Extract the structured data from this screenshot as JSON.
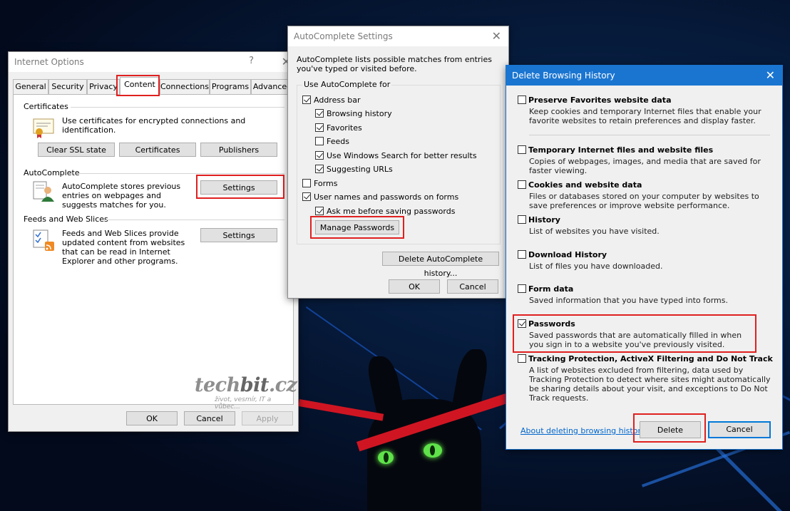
{
  "internet_options": {
    "title": "Internet Options",
    "help": "?",
    "close": "✕",
    "tabs": [
      "General",
      "Security",
      "Privacy",
      "Content",
      "Connections",
      "Programs",
      "Advanced"
    ],
    "selected_tab": "Content",
    "certificates": {
      "heading": "Certificates",
      "text": "Use certificates for encrypted connections and identification.",
      "buttons": [
        "Clear SSL state",
        "Certificates",
        "Publishers"
      ]
    },
    "autocomplete": {
      "heading": "AutoComplete",
      "text": "AutoComplete stores previous entries on webpages and suggests matches for you.",
      "button": "Settings"
    },
    "feeds": {
      "heading": "Feeds and Web Slices",
      "text": "Feeds and Web Slices provide updated content from websites that can be read in Internet Explorer and other programs.",
      "button": "Settings"
    },
    "watermark": {
      "part1": "tech",
      "part2": "bit",
      "part3": ".cz",
      "tagline": "život, vesmír, IT a vůbec..."
    },
    "footer": {
      "ok": "OK",
      "cancel": "Cancel",
      "apply": "Apply"
    }
  },
  "autocomplete_settings": {
    "title": "AutoComplete Settings",
    "close": "✕",
    "intro": "AutoComplete lists possible matches from entries you've typed or visited before.",
    "group_label": "Use AutoComplete for",
    "options": {
      "address_bar": {
        "label": "Address bar",
        "checked": true
      },
      "browsing_history": {
        "label": "Browsing history",
        "checked": true
      },
      "favorites": {
        "label": "Favorites",
        "checked": true
      },
      "feeds": {
        "label": "Feeds",
        "checked": false
      },
      "windows_search": {
        "label": "Use Windows Search for better results",
        "checked": true
      },
      "suggesting_urls": {
        "label": "Suggesting URLs",
        "checked": true
      },
      "forms": {
        "label": "Forms",
        "checked": false
      },
      "usernames": {
        "label": "User names and passwords on forms",
        "checked": true
      },
      "ask_before": {
        "label": "Ask me before saving passwords",
        "checked": true
      }
    },
    "manage_passwords": "Manage Passwords",
    "delete_history": "Delete AutoComplete history...",
    "ok": "OK",
    "cancel": "Cancel"
  },
  "delete_history": {
    "title": "Delete Browsing History",
    "close": "✕",
    "items": {
      "preserve": {
        "label": "Preserve Favorites website data",
        "desc": "Keep cookies and temporary Internet files that enable your favorite websites to retain preferences and display faster.",
        "checked": false
      },
      "temp_files": {
        "label": "Temporary Internet files and website files",
        "desc": "Copies of webpages, images, and media that are saved for faster viewing.",
        "checked": false
      },
      "cookies": {
        "label": "Cookies and website data",
        "desc": "Files or databases stored on your computer by websites to save preferences or improve website performance.",
        "checked": false
      },
      "history": {
        "label": "History",
        "desc": "List of websites you have visited.",
        "checked": false
      },
      "download_history": {
        "label": "Download History",
        "desc": "List of files you have downloaded.",
        "checked": false
      },
      "form_data": {
        "label": "Form data",
        "desc": "Saved information that you have typed into forms.",
        "checked": false
      },
      "passwords": {
        "label": "Passwords",
        "desc": "Saved passwords that are automatically filled in when you sign in to a website you've previously visited.",
        "checked": true
      },
      "tracking": {
        "label": "Tracking Protection, ActiveX Filtering and Do Not Track",
        "desc": "A list of websites excluded from filtering, data used by Tracking Protection to detect where sites might automatically be sharing details about your visit, and exceptions to Do Not Track requests.",
        "checked": false
      }
    },
    "about_link": "About deleting browsing history",
    "delete": "Delete",
    "cancel": "Cancel"
  },
  "colors": {
    "highlight": "#e02020",
    "active_title": "#1a75d1",
    "link": "#0066cc"
  }
}
